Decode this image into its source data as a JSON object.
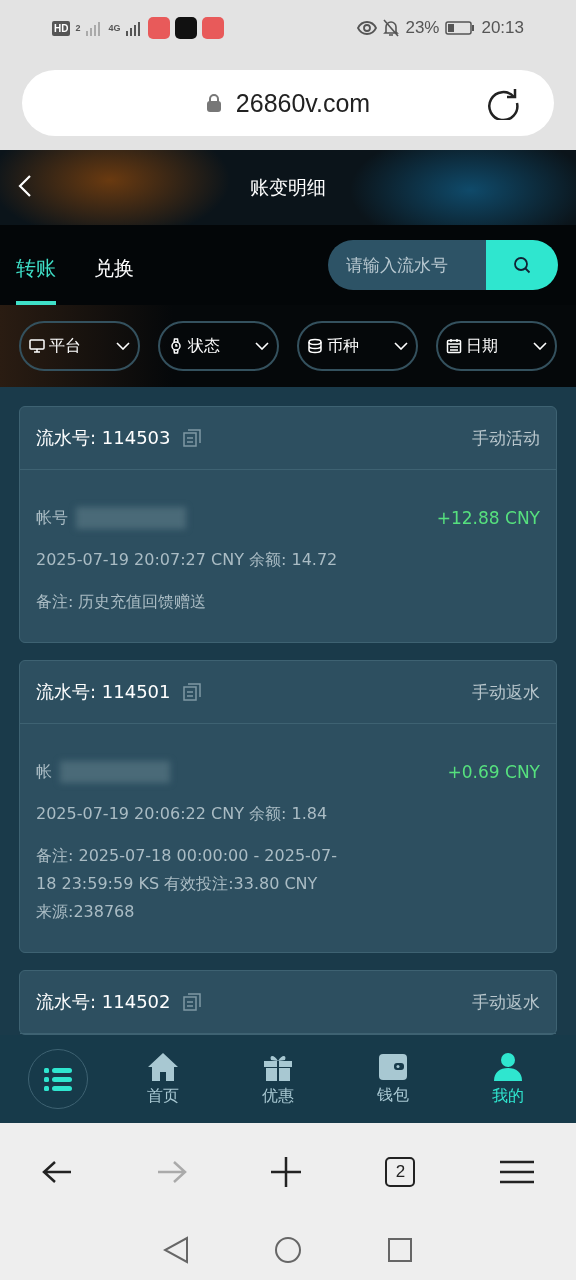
{
  "status_bar": {
    "hd": "HD",
    "sim": "2",
    "network": "4G",
    "battery": "23%",
    "time": "20:13"
  },
  "browser": {
    "url": "26860v.com",
    "tab_count": "2",
    "forward_disabled": true
  },
  "header": {
    "title": "账变明细"
  },
  "tabs": [
    {
      "label": "转账",
      "selected": true
    },
    {
      "label": "兑换",
      "selected": false
    }
  ],
  "search": {
    "placeholder": "请输入流水号"
  },
  "filters": [
    {
      "kind": "platform",
      "label": "平台"
    },
    {
      "kind": "status",
      "label": "状态"
    },
    {
      "kind": "currency",
      "label": "币种"
    },
    {
      "kind": "date",
      "label": "日期"
    }
  ],
  "records": [
    {
      "serial": "流水号: 114503",
      "type": "手动活动",
      "account": "帐号",
      "amount": "+12.88 CNY",
      "time_balance": "2025-07-19 20:07:27 CNY 余额: 14.72",
      "remark": "备注: 历史充值回馈赠送"
    },
    {
      "serial": "流水号: 114501",
      "type": "手动返水",
      "account": "帐",
      "amount": "+0.69 CNY",
      "time_balance": "2025-07-19 20:06:22 CNY 余额: 1.84",
      "remark": "备注: 2025-07-18 00:00:00 - 2025-07-18 23:59:59 KS 有效投注:33.80 CNY",
      "source": "来源:238768"
    },
    {
      "serial": "流水号: 114502",
      "type": "手动返水"
    }
  ],
  "bottom_nav": [
    {
      "kind": "menu",
      "selected": false
    },
    {
      "kind": "home",
      "label": "首页",
      "selected": false
    },
    {
      "kind": "gift",
      "label": "优惠",
      "selected": false
    },
    {
      "kind": "wallet",
      "label": "钱包",
      "selected": false
    },
    {
      "kind": "user",
      "label": "我的",
      "selected": true
    }
  ]
}
